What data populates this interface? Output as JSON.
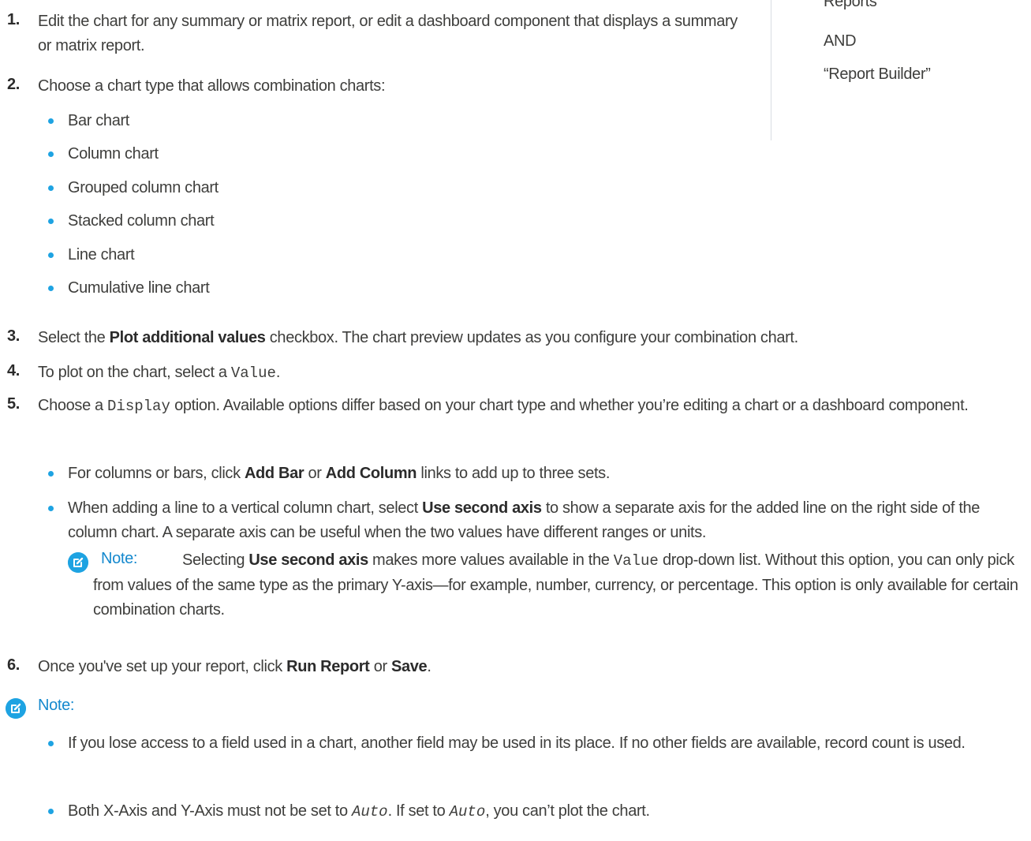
{
  "permissions": {
    "line1": "Reports”",
    "line2": "AND",
    "line3": "“Report Builder”"
  },
  "steps": [
    {
      "number": "1.",
      "text": "Edit the chart for any summary or matrix report, or edit a dashboard component that displays a summary or matrix report."
    },
    {
      "number": "2.",
      "text": "Choose a chart type that allows combination charts:",
      "bullets": [
        "Bar chart",
        "Column chart",
        "Grouped column chart",
        "Stacked column chart",
        "Line chart",
        "Cumulative line chart"
      ]
    },
    {
      "number": "3.",
      "pre": "Select the ",
      "bold": "Plot additional values",
      "post": " checkbox. The chart preview updates as you configure your combination chart."
    },
    {
      "number": "4.",
      "pre": "To plot on the chart, select a ",
      "code": "Value",
      "post": "."
    },
    {
      "number": "5.",
      "pre": "Choose a ",
      "code": "Display",
      "post": " option. Available options differ based on your chart type and whether you’re editing a chart or a dashboard component.",
      "bullet1": {
        "pre": "For columns or bars, click ",
        "bold1": "Add Bar",
        "mid": " or ",
        "bold2": "Add Column",
        "post": " links to add up to three sets."
      },
      "bullet2": {
        "pre": "When adding a line to a vertical column chart, select ",
        "bold": "Use second axis",
        "post": " to show a separate axis for the added line on the right side of the column chart. A separate axis can be useful when the two values have different ranges or units."
      },
      "note": {
        "label": "Note:",
        "pre": "Selecting ",
        "bold": "Use second axis",
        "mid": " makes more values available in the ",
        "code": "Value",
        "post": " drop-down list. Without this option, you can only pick from values of the same type as the primary Y-axis—for example, number, currency, or percentage. This option is only available for certain combination charts."
      }
    },
    {
      "number": "6.",
      "pre": "Once you've set up your report, click ",
      "bold1": "Run Report",
      "mid": " or ",
      "bold2": "Save",
      "post": "."
    }
  ],
  "bottom_note": {
    "label": "Note:",
    "bullet1": "If you lose access to a field used in a chart, another field may be used in its place. If no other fields are available, record count is used.",
    "bullet2": {
      "pre": "Both X-Axis and Y-Axis must not be set to ",
      "code1": "Auto",
      "mid": ". If set to ",
      "code2": "Auto",
      "post": ", you can’t plot the chart."
    }
  },
  "colors": {
    "text": "#3e3e3c",
    "accent": "#1ea3e2",
    "note_label": "#1589ce",
    "divider": "#d9dde2"
  },
  "icons": [
    "note-edit-icon",
    "bullet-dot-icon"
  ]
}
